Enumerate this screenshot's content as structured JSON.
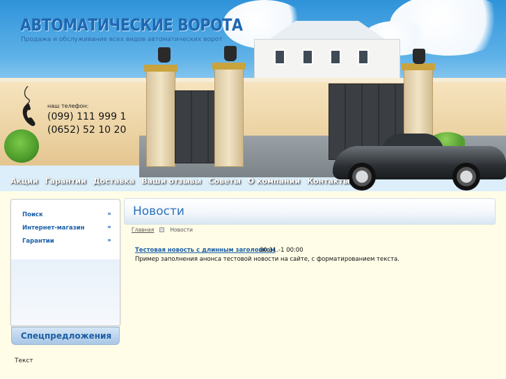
{
  "header": {
    "title": "АВТОМАТИЧЕСКИЕ ВОРОТА",
    "subtitle": "Продажа и обслуживание всех видов автоматических ворот",
    "phone_label": "наш телефон:",
    "phones": [
      "(099) 111 999 1",
      "(0652) 52 10 20"
    ]
  },
  "nav": {
    "items": [
      "Акции",
      "Гарантии",
      "Доставка",
      "Ваши отзывы",
      "Советы",
      "О компании",
      "Контакты"
    ]
  },
  "sidebar": {
    "items": [
      {
        "label": "Поиск",
        "arrow": "»"
      },
      {
        "label": "Интернет-магазин",
        "arrow": "»"
      },
      {
        "label": "Гарантии",
        "arrow": "»"
      }
    ],
    "specials_title": "Спецпредложения",
    "text": "Текст"
  },
  "content": {
    "title": "Новости",
    "breadcrumb": {
      "home": "Главная",
      "current": "Новости"
    },
    "news": [
      {
        "title": "Тестовая новость с длинным заголовком",
        "date": "30.11.-1 00:00",
        "summary": "Пример заполнения анонса тестовой новости на сайте, с форматированием текста."
      }
    ]
  },
  "colors": {
    "accent": "#2a72bd",
    "link": "#1b5fa8",
    "title": "#1f67b1"
  }
}
